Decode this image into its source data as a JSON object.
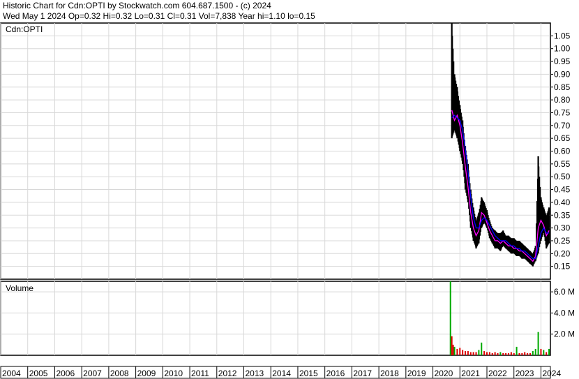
{
  "header": {
    "line1": "Historic Chart for Cdn:OPTI by Stockwatch.com 604.687.1500 - (c) 2024",
    "line2": "Wed May  1 2024   Op=0.32  Hi=0.32  Lo=0.31  Cl=0.31  Vol=7,838  Year hi=1.10  lo=0.15"
  },
  "price_panel": {
    "label": "Cdn:OPTI"
  },
  "volume_panel": {
    "label": "Volume"
  },
  "chart_data": [
    {
      "type": "line",
      "title": "Cdn:OPTI",
      "x_axis": {
        "type": "year",
        "tick_labels": [
          "2004",
          "2005",
          "2006",
          "2007",
          "2008",
          "2009",
          "2010",
          "2011",
          "2012",
          "2013",
          "2014",
          "2015",
          "2016",
          "2017",
          "2018",
          "2019",
          "2020",
          "2021",
          "2022",
          "2023",
          "2024"
        ]
      },
      "y_axis": {
        "range": [
          0.1,
          1.1
        ],
        "tick_labels": [
          "1.05",
          "1.00",
          "0.95",
          "0.90",
          "0.85",
          "0.80",
          "0.75",
          "0.70",
          "0.65",
          "0.60",
          "0.55",
          "0.50",
          "0.45",
          "0.40",
          "0.35",
          "0.30",
          "0.25",
          "0.20",
          "0.15"
        ]
      },
      "grid": true,
      "series": [
        {
          "color": "#000000",
          "style": "high-low bars",
          "x": [
            2020.7,
            2020.8,
            2020.9,
            2021.0,
            2021.1,
            2021.2,
            2021.3,
            2021.4,
            2021.5,
            2021.6,
            2021.7,
            2021.8,
            2021.9,
            2022.0,
            2022.1,
            2022.2,
            2022.3,
            2022.4,
            2022.5,
            2022.6,
            2022.7,
            2022.8,
            2022.9,
            2023.0,
            2023.1,
            2023.2,
            2023.3,
            2023.4,
            2023.5,
            2023.6,
            2023.7,
            2023.8,
            2023.9,
            2024.0,
            2024.1,
            2024.2,
            2024.3
          ],
          "low": [
            0.65,
            0.68,
            0.65,
            0.6,
            0.55,
            0.45,
            0.4,
            0.3,
            0.25,
            0.22,
            0.24,
            0.3,
            0.32,
            0.3,
            0.26,
            0.24,
            0.22,
            0.22,
            0.21,
            0.23,
            0.22,
            0.21,
            0.2,
            0.2,
            0.19,
            0.19,
            0.18,
            0.18,
            0.17,
            0.16,
            0.15,
            0.17,
            0.2,
            0.25,
            0.28,
            0.22,
            0.24
          ],
          "high": [
            1.1,
            0.9,
            0.85,
            0.78,
            0.72,
            0.62,
            0.55,
            0.45,
            0.38,
            0.33,
            0.36,
            0.42,
            0.4,
            0.37,
            0.33,
            0.3,
            0.29,
            0.28,
            0.28,
            0.29,
            0.27,
            0.27,
            0.26,
            0.26,
            0.25,
            0.25,
            0.24,
            0.23,
            0.22,
            0.21,
            0.2,
            0.23,
            0.58,
            0.42,
            0.38,
            0.35,
            0.38
          ]
        },
        {
          "color": "#ff00ff",
          "style": "line",
          "x": [
            2020.7,
            2020.8,
            2020.9,
            2021.0,
            2021.1,
            2021.2,
            2021.3,
            2021.4,
            2021.5,
            2021.6,
            2021.7,
            2021.8,
            2021.9,
            2022.0,
            2022.1,
            2022.2,
            2022.3,
            2022.4,
            2022.5,
            2022.6,
            2022.7,
            2022.8,
            2022.9,
            2023.0,
            2023.1,
            2023.2,
            2023.3,
            2023.4,
            2023.5,
            2023.6,
            2023.7,
            2023.8,
            2023.9,
            2024.0,
            2024.1,
            2024.2,
            2024.3
          ],
          "y": [
            0.76,
            0.72,
            0.74,
            0.7,
            0.63,
            0.54,
            0.46,
            0.36,
            0.3,
            0.27,
            0.29,
            0.36,
            0.35,
            0.32,
            0.29,
            0.27,
            0.25,
            0.25,
            0.24,
            0.25,
            0.24,
            0.23,
            0.23,
            0.22,
            0.22,
            0.21,
            0.21,
            0.2,
            0.19,
            0.18,
            0.17,
            0.19,
            0.3,
            0.33,
            0.31,
            0.27,
            0.29
          ]
        },
        {
          "color": "#0000ff",
          "style": "line",
          "x": [
            2020.7,
            2020.8,
            2020.9,
            2021.0,
            2021.1,
            2021.2,
            2021.3,
            2021.4,
            2021.5,
            2021.6,
            2021.7,
            2021.8,
            2021.9,
            2022.0,
            2022.1,
            2022.2,
            2022.3,
            2022.4,
            2022.5,
            2022.6,
            2022.7,
            2022.8,
            2022.9,
            2023.0,
            2023.1,
            2023.2,
            2023.3,
            2023.4,
            2023.5,
            2023.6,
            2023.7,
            2023.8,
            2023.9,
            2024.0,
            2024.1,
            2024.2,
            2024.3
          ],
          "y": [
            0.73,
            0.74,
            0.73,
            0.72,
            0.68,
            0.61,
            0.52,
            0.42,
            0.34,
            0.3,
            0.3,
            0.33,
            0.34,
            0.33,
            0.31,
            0.29,
            0.27,
            0.26,
            0.25,
            0.25,
            0.25,
            0.24,
            0.23,
            0.23,
            0.22,
            0.22,
            0.21,
            0.21,
            0.2,
            0.19,
            0.18,
            0.18,
            0.23,
            0.28,
            0.3,
            0.28,
            0.28
          ]
        }
      ]
    },
    {
      "type": "bar",
      "title": "Volume",
      "x_axis": {
        "type": "year"
      },
      "y_axis": {
        "range": [
          0,
          7.0
        ],
        "unit": "M",
        "tick_labels": [
          "6.0 M",
          "4.0 M",
          "2.0 M"
        ]
      },
      "grid": true,
      "series": [
        {
          "color_up": "#00aa00",
          "color_down": "#dd0000",
          "x": [
            2020.65,
            2020.7,
            2020.75,
            2020.8,
            2020.9,
            2021.0,
            2021.1,
            2021.2,
            2021.3,
            2021.4,
            2021.5,
            2021.6,
            2021.7,
            2021.8,
            2021.9,
            2022.0,
            2022.1,
            2022.2,
            2022.3,
            2022.4,
            2022.5,
            2022.6,
            2022.7,
            2022.8,
            2022.9,
            2023.0,
            2023.1,
            2023.2,
            2023.3,
            2023.4,
            2023.5,
            2023.6,
            2023.7,
            2023.8,
            2023.9,
            2024.0,
            2024.1,
            2024.2,
            2024.3
          ],
          "values": [
            7.0,
            1.8,
            1.0,
            0.8,
            0.6,
            0.7,
            0.5,
            0.4,
            0.4,
            0.3,
            0.3,
            0.3,
            0.5,
            1.2,
            0.4,
            0.3,
            0.3,
            0.2,
            0.3,
            0.2,
            0.3,
            0.2,
            0.2,
            0.2,
            0.3,
            0.2,
            0.8,
            0.2,
            0.2,
            0.3,
            0.2,
            0.2,
            0.4,
            0.6,
            2.2,
            0.6,
            0.5,
            0.3,
            0.6
          ],
          "up": [
            true,
            false,
            false,
            true,
            false,
            false,
            false,
            false,
            false,
            false,
            false,
            false,
            true,
            true,
            false,
            false,
            false,
            false,
            false,
            false,
            true,
            false,
            false,
            false,
            false,
            false,
            true,
            false,
            false,
            false,
            false,
            false,
            true,
            true,
            true,
            false,
            true,
            false,
            true
          ]
        }
      ]
    }
  ]
}
